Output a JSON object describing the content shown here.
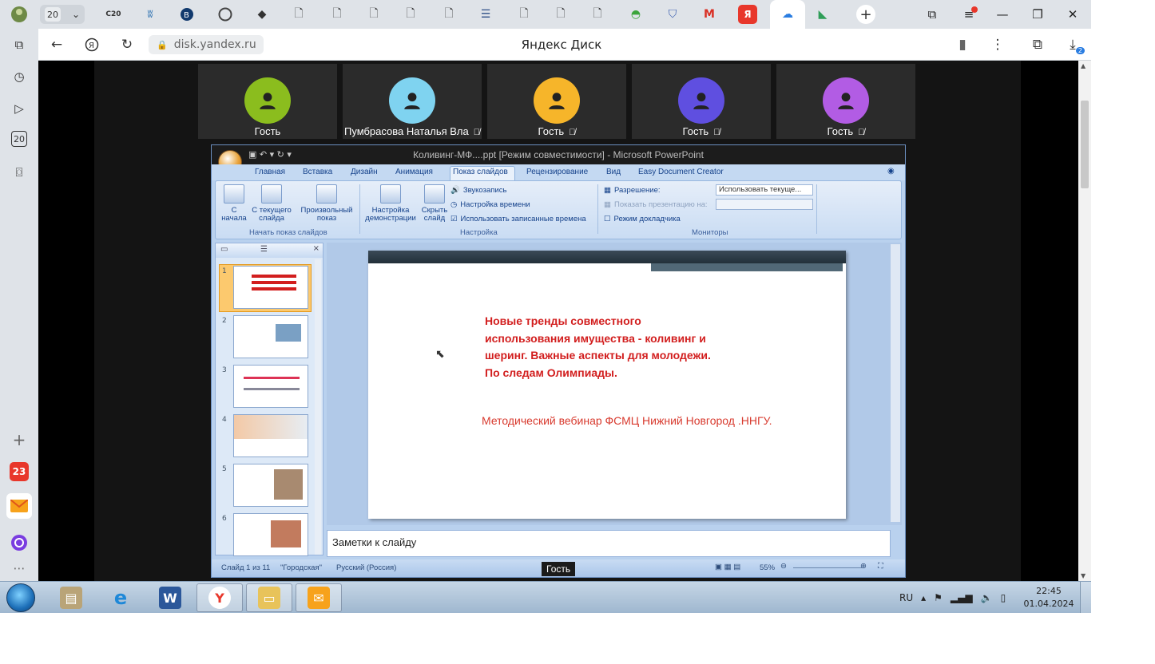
{
  "browser": {
    "tab_counter": "20",
    "address": "disk.yandex.ru",
    "page_title": "Яндекс Диск",
    "downloads_badge": "2",
    "tab_icons": [
      "c20-icon",
      "vk-icon",
      "hse-icon",
      "browser-icon",
      "diamond-icon",
      "doc-icon",
      "doc-icon",
      "doc-icon",
      "doc-icon",
      "doc-icon",
      "stack-icon",
      "doc-icon",
      "doc-icon",
      "doc-icon",
      "android-icon",
      "shield-icon",
      "gmail-icon",
      "yandex-icon",
      "disk-icon",
      "maps-icon"
    ]
  },
  "sidebar": {
    "items": [
      "collections-icon",
      "history-icon",
      "video-icon",
      "tabs-icon",
      "screenshot-icon"
    ],
    "add_label": "+",
    "calendar_badge": "23"
  },
  "conference": {
    "participants": [
      {
        "name": "Гость",
        "color": "#8bbd1e",
        "muted": false
      },
      {
        "name": "Пумбрасова Наталья Вла",
        "color": "#7fd3f0",
        "muted": true
      },
      {
        "name": "Гость",
        "color": "#f6b52a",
        "muted": true
      },
      {
        "name": "Гость",
        "color": "#5f4fe0",
        "muted": true
      },
      {
        "name": "Гость",
        "color": "#b25ce4",
        "muted": true
      }
    ],
    "presenter_label": "Гость"
  },
  "ppt": {
    "window_title": "Коливинг-МФ....ppt [Режим совместимости] - Microsoft PowerPoint",
    "tabs": [
      "Главная",
      "Вставка",
      "Дизайн",
      "Анимация",
      "Показ слайдов",
      "Рецензирование",
      "Вид",
      "Easy Document Creator"
    ],
    "active_tab": "Показ слайдов",
    "ribbon": {
      "from_start": "С начала",
      "from_current": "С текущего слайда",
      "custom_show": "Произвольный показ",
      "group_start": "Начать показ слайдов",
      "setup_show": "Настройка демонстрации",
      "hide_slide": "Скрыть слайд",
      "record_narration": "Звукозапись",
      "rehearse_timings": "Настройка времени",
      "use_timings": "Использовать записанные времена",
      "group_setup": "Настройка",
      "resolution_label": "Разрешение:",
      "resolution_value": "Использовать текуще...",
      "show_on_label": "Показать презентацию на:",
      "presenter_view": "Режим докладчика",
      "group_monitors": "Мониторы"
    },
    "slide": {
      "title": "Новые тренды совместного использования имущества - коливинг и шеринг. Важные аспекты для молодежи. По следам Олимпиады.",
      "subtitle": "Методический вебинар ФСМЦ Нижний Новгород .ННГУ."
    },
    "thumbnails": [
      "1",
      "2",
      "3",
      "4",
      "5",
      "6"
    ],
    "notes_placeholder": "Заметки к слайду",
    "status": {
      "slide_of": "Слайд 1 из 11",
      "theme": "\"Городская\"",
      "language": "Русский (Россия)",
      "zoom": "55%"
    }
  },
  "taskbar": {
    "language": "RU",
    "time": "22:45",
    "date": "01.04.2024"
  }
}
